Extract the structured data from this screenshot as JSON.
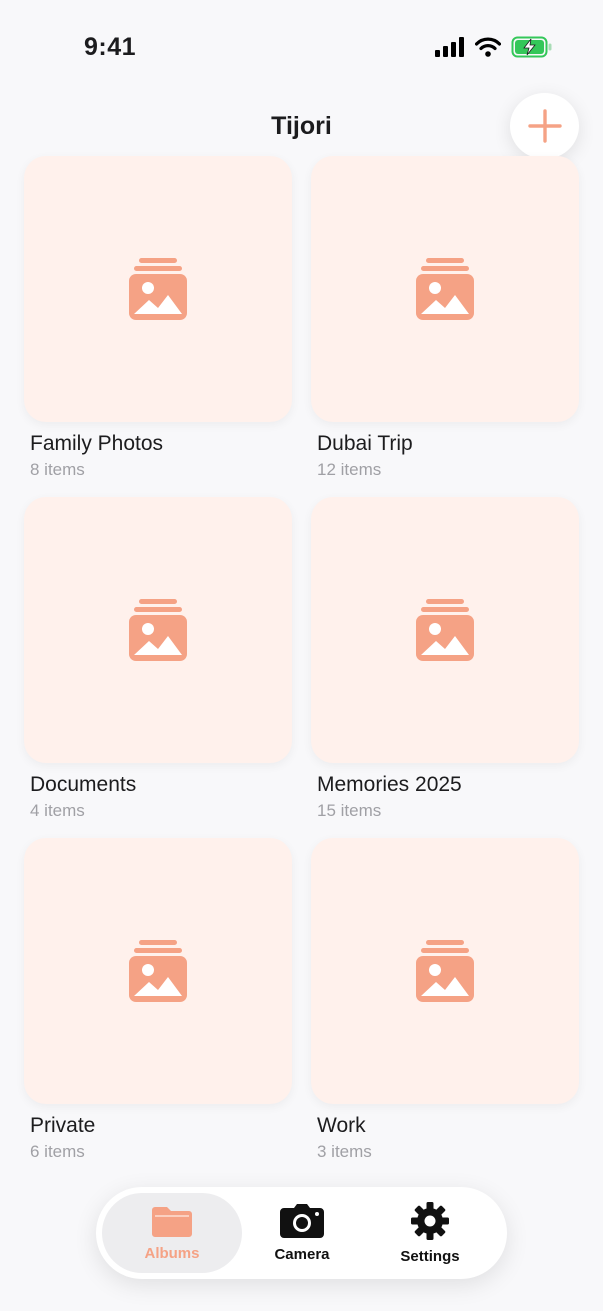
{
  "status_bar": {
    "time": "9:41"
  },
  "header": {
    "title": "Tijori"
  },
  "albums": [
    {
      "name": "Family Photos",
      "count": "8 items"
    },
    {
      "name": "Dubai Trip",
      "count": "12 items"
    },
    {
      "name": "Documents",
      "count": "4 items"
    },
    {
      "name": "Memories 2025",
      "count": "15 items"
    },
    {
      "name": "Private",
      "count": "6 items"
    },
    {
      "name": "Work",
      "count": "3 items"
    }
  ],
  "tab_bar": {
    "items": [
      {
        "label": "Albums",
        "icon": "folder-icon",
        "selected": true
      },
      {
        "label": "Camera",
        "icon": "camera-icon",
        "selected": false
      },
      {
        "label": "Settings",
        "icon": "gear-icon",
        "selected": false
      }
    ]
  },
  "colors": {
    "accent": "#f5a285",
    "card_background": "#fff1ec",
    "page_background": "#f8f8fa",
    "battery": "#34c759"
  }
}
